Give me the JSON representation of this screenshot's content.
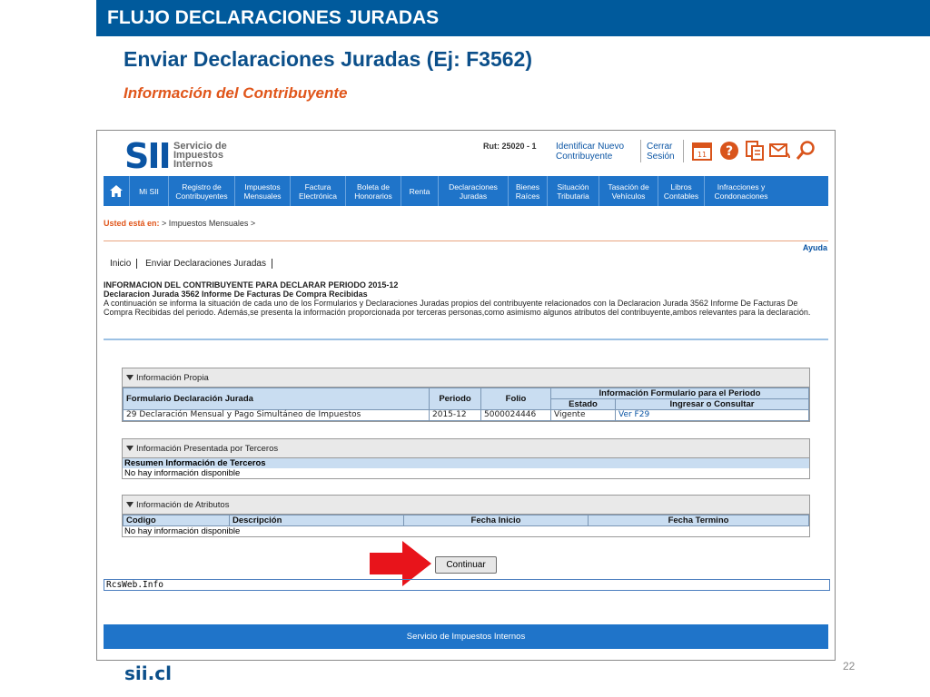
{
  "slide": {
    "banner": "FLUJO DECLARACIONES JURADAS",
    "title": "Enviar Declaraciones Juradas (Ej: F3562)",
    "subtitle": "Información del Contribuyente",
    "brand": "sii.cl",
    "page_number": "22"
  },
  "header": {
    "logo_mark": "SII",
    "logo_lines": [
      "Servicio de",
      "Impuestos",
      "Internos"
    ],
    "rut": "Rut: 25020 - 1",
    "identify_link": [
      "Identificar Nuevo",
      "Contribuyente"
    ],
    "logout_link": [
      "Cerrar",
      "Sesión"
    ],
    "icons": [
      "calendar-icon",
      "help-icon",
      "documents-icon",
      "mail-icon",
      "search-icon"
    ]
  },
  "nav": {
    "home_icon": "home-icon",
    "items": [
      "Mi SII",
      "Registro de Contribuyentes",
      "Impuestos Mensuales",
      "Factura Electrónica",
      "Boleta de Honorarios",
      "Renta",
      "Declaraciones Juradas",
      "Bienes Raíces",
      "Situación Tributaria",
      "Tasación de Vehículos",
      "Libros Contables",
      "Infracciones y Condonaciones"
    ]
  },
  "breadcrumb": {
    "prefix": "Usted está en:",
    "path": "> Impuestos Mensuales >"
  },
  "ayuda": "Ayuda",
  "tabs": [
    "Inicio",
    "Enviar Declaraciones Juradas"
  ],
  "info": {
    "heading": "INFORMACION DEL CONTRIBUYENTE PARA DECLARAR PERIODO 2015-12",
    "subheading": "Declaracion Jurada 3562 Informe De Facturas De Compra Recibidas",
    "body": "A continuación se informa la situación de cada uno de los Formularios y Declaraciones Juradas propios del contribuyente relacionados con la Declaracion Jurada 3562 Informe De Facturas De Compra Recibidas del periodo. Además,se presenta la información proporcionada por terceras personas,como asimismo algunos atributos del contribuyente,ambos relevantes para la declaración."
  },
  "panel_propia": {
    "title": "Información Propia",
    "headers": {
      "formulario": "Formulario Declaración Jurada",
      "periodo": "Periodo",
      "folio": "Folio",
      "info_group": "Información Formulario para el Periodo",
      "estado": "Estado",
      "ingresar": "Ingresar o Consultar"
    },
    "row": {
      "formulario": "29 Declaración Mensual y Pago Simultáneo de Impuestos",
      "periodo": "2015-12",
      "folio": "5000024446",
      "estado": "Vigente",
      "link": "Ver F29"
    }
  },
  "panel_terceros": {
    "title": "Información Presentada por Terceros",
    "subheading": "Resumen Información de Terceros",
    "empty": "No hay información disponible"
  },
  "panel_atributos": {
    "title": "Información de Atributos",
    "headers": [
      "Codigo",
      "Descripción",
      "Fecha Inicio",
      "Fecha Termino"
    ],
    "empty": "No hay información disponible"
  },
  "continue_button": "Continuar",
  "rcs": "RcsWeb.Info",
  "footer": "Servicio de Impuestos Internos",
  "colors": {
    "banner": "#005a9c",
    "nav": "#1f74c9",
    "accent": "#e0561b",
    "table_header": "#c9ddf1",
    "arrow": "#e8141b"
  }
}
